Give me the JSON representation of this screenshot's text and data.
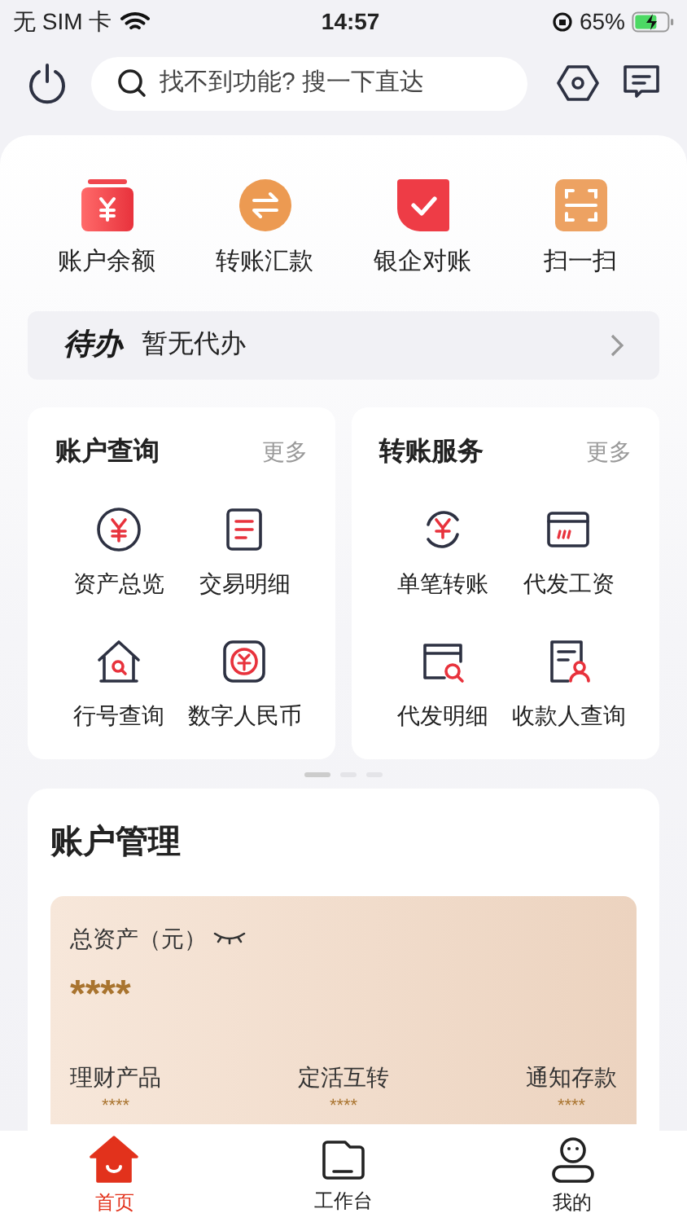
{
  "status_bar": {
    "carrier": "无 SIM 卡",
    "time": "14:57",
    "battery": "65%"
  },
  "search": {
    "placeholder": "找不到功能? 搜一下直达"
  },
  "quick_actions": [
    {
      "label": "账户余额"
    },
    {
      "label": "转账汇款"
    },
    {
      "label": "银企对账"
    },
    {
      "label": "扫一扫"
    }
  ],
  "todo": {
    "badge": "待办",
    "text": "暂无代办"
  },
  "service_cards": [
    {
      "title": "账户查询",
      "more": "更多",
      "items": [
        {
          "label": "资产总览"
        },
        {
          "label": "交易明细"
        },
        {
          "label": "行号查询"
        },
        {
          "label": "数字人民币"
        }
      ]
    },
    {
      "title": "转账服务",
      "more": "更多",
      "items": [
        {
          "label": "单笔转账"
        },
        {
          "label": "代发工资"
        },
        {
          "label": "代发明细"
        },
        {
          "label": "收款人查询"
        }
      ]
    }
  ],
  "pages": [
    {
      "selected": true
    },
    {
      "selected": false
    },
    {
      "selected": false
    }
  ],
  "account_management": {
    "title": "账户管理",
    "total_label": "总资产（元）",
    "total_value": "****",
    "products": [
      {
        "label": "理财产品",
        "value": "****"
      },
      {
        "label": "定活互转",
        "value": "****"
      },
      {
        "label": "通知存款",
        "value": "****"
      }
    ]
  },
  "bottom_nav": [
    {
      "label": "首页",
      "selected": true
    },
    {
      "label": "工作台",
      "selected": false
    },
    {
      "label": "我的",
      "selected": false
    }
  ]
}
